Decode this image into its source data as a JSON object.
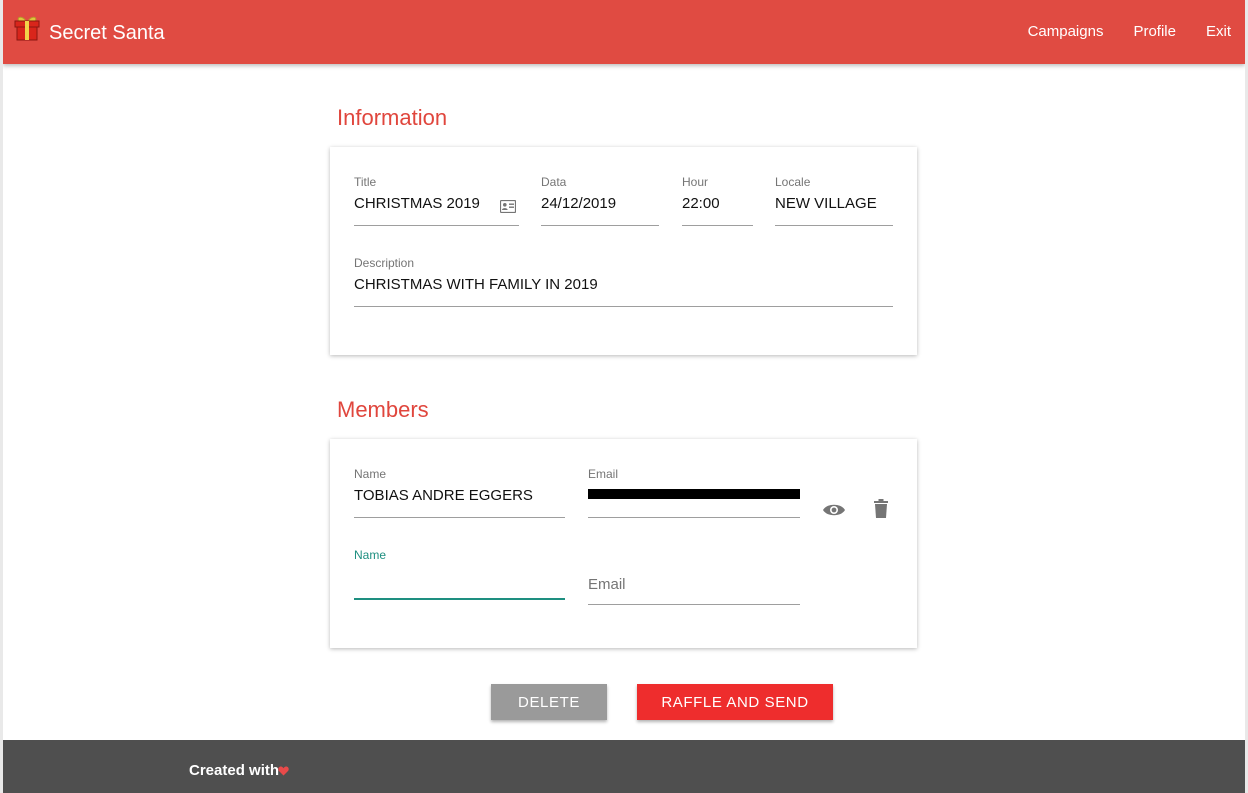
{
  "app": {
    "title": "Secret Santa",
    "logo_icon": "gift-icon"
  },
  "nav": {
    "items": [
      "Campaigns",
      "Profile",
      "Exit"
    ]
  },
  "colors": {
    "header": "#e04b42",
    "accent": "#e0463d",
    "focus": "#1e8f80",
    "raffle_button": "#ee2d2d",
    "delete_button": "#9a9a9a",
    "footer": "#4f4f4f"
  },
  "information": {
    "section_title": "Information",
    "title": {
      "label": "Title",
      "value": "CHRISTMAS 2019",
      "icon": "contact-card-icon"
    },
    "date": {
      "label": "Data",
      "value": "24/12/2019"
    },
    "hour": {
      "label": "Hour",
      "value": "22:00"
    },
    "locale": {
      "label": "Locale",
      "value": "NEW VILLAGE"
    },
    "description": {
      "label": "Description",
      "value": "CHRISTMAS WITH FAMILY IN 2019"
    }
  },
  "members": {
    "section_title": "Members",
    "rows": [
      {
        "name_label": "Name",
        "name": "TOBIAS ANDRE EGGERS",
        "email_label": "Email",
        "email": "",
        "email_redacted": true,
        "view_icon": "eye-icon",
        "delete_icon": "trash-icon"
      }
    ],
    "new_member": {
      "name_label": "Name",
      "name": "",
      "email_placeholder": "Email"
    }
  },
  "actions": {
    "delete": "DELETE",
    "raffle": "RAFFLE AND SEND"
  },
  "footer": {
    "text": "Created with",
    "icon": "heart-icon"
  }
}
